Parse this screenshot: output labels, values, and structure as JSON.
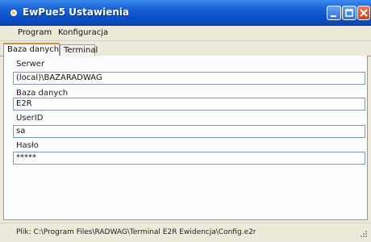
{
  "window": {
    "title": "EwPue5 Ustawienia",
    "accent_color": "#0a4fc8"
  },
  "menu": {
    "items": [
      "Program",
      "Konfiguracja"
    ]
  },
  "tabs": [
    {
      "label": "Baza danych",
      "active": true
    },
    {
      "label": "Terminal",
      "active": false
    }
  ],
  "form": {
    "server_label": "Serwer",
    "server_value": "(local)\\BAZARADWAG",
    "database_label": "Baza danych",
    "database_value": "E2R",
    "userid_label": "UserID",
    "userid_value": "sa",
    "password_label": "Hasło",
    "password_value": "*****"
  },
  "status": {
    "text": "Plik: C:\\Program Files\\RADWAG\\Terminal E2R Ewidencja\\Config.e2r"
  },
  "icons": {
    "app": "app-icon",
    "minimize": "minimize-icon",
    "maximize": "maximize-icon",
    "close": "close-icon",
    "grip": "resize-grip-icon"
  }
}
